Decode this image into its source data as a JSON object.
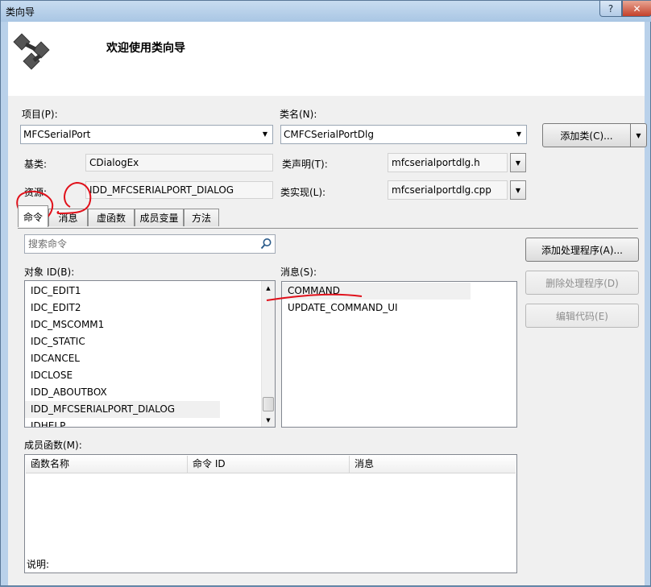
{
  "window": {
    "title": "类向导",
    "help_glyph": "?",
    "close_glyph": "✕"
  },
  "header": {
    "welcome": "欢迎使用类向导"
  },
  "form": {
    "project_label": "项目(P):",
    "project_value": "MFCSerialPort",
    "class_name_label": "类名(N):",
    "class_name_value": "CMFCSerialPortDlg",
    "add_class_button": "添加类(C)...",
    "base_class_label": "基类:",
    "base_class_value": "CDialogEx",
    "class_decl_label": "类声明(T):",
    "class_decl_value": "mfcserialportdlg.h",
    "resource_label": "资源:",
    "resource_value": "IDD_MFCSERIALPORT_DIALOG",
    "class_impl_label": "类实现(L):",
    "class_impl_value": "mfcserialportdlg.cpp"
  },
  "tabs": [
    {
      "label": "命令",
      "active": true
    },
    {
      "label": "消息",
      "active": false
    },
    {
      "label": "虚函数",
      "active": false
    },
    {
      "label": "成员变量",
      "active": false
    },
    {
      "label": "方法",
      "active": false
    }
  ],
  "commands": {
    "search_placeholder": "搜索命令",
    "object_ids_label": "对象 ID(B):",
    "object_ids": [
      "IDC_EDIT1",
      "IDC_EDIT2",
      "IDC_MSCOMM1",
      "IDC_STATIC",
      "IDCANCEL",
      "IDCLOSE",
      "IDD_ABOUTBOX",
      "IDD_MFCSERIALPORT_DIALOG",
      "IDHELP"
    ],
    "selected_object_id": "IDD_MFCSERIALPORT_DIALOG",
    "messages_label": "消息(S):",
    "messages": [
      "COMMAND",
      "UPDATE_COMMAND_UI"
    ],
    "selected_message": "COMMAND",
    "add_handler_button": "添加处理程序(A)...",
    "delete_handler_button": "删除处理程序(D)",
    "edit_code_button": "编辑代码(E)",
    "member_functions_label": "成员函数(M):",
    "member_function_columns": [
      "函数名称",
      "命令 ID",
      "消息"
    ],
    "description_label": "说明:"
  },
  "colors": {
    "annotation_ink": "#e0101a",
    "dialog_bg": "#f0f0f0",
    "frame": "#b9d1ea"
  }
}
